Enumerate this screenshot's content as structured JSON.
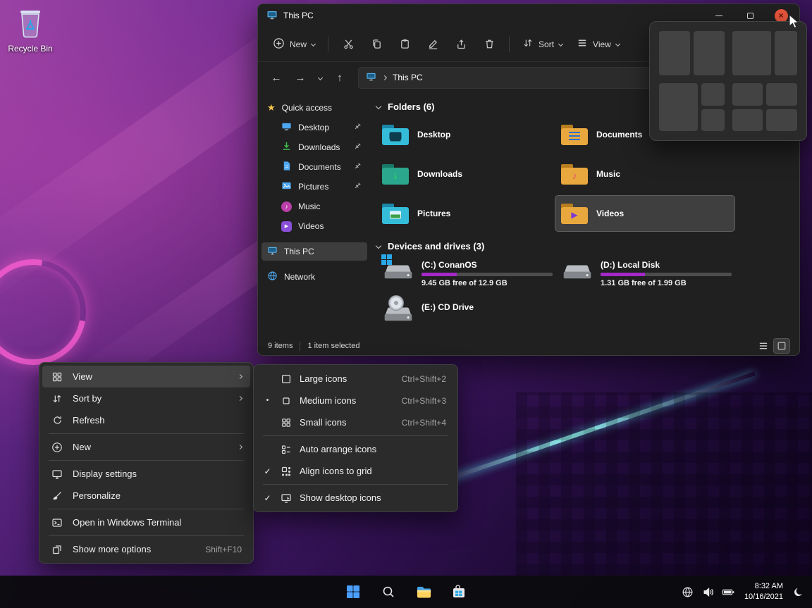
{
  "desktop": {
    "recycle_bin_label": "Recycle Bin"
  },
  "colors": {
    "drive_used_bar": "#a428c9",
    "close_button": "#e8563c",
    "selection_bg": "#3d3d3d",
    "folder_teal": "#35bcd9",
    "folder_amber": "#e8a83e"
  },
  "icons": {
    "star": "★",
    "music_note": "♪",
    "play": "▶",
    "down_arrow": "↓",
    "check": "✓",
    "bullet": "•",
    "close": "×",
    "back_arrow": "←",
    "forward_arrow": "→",
    "up_arrow": "↑"
  },
  "explorer": {
    "title": "This PC",
    "toolbar": {
      "new": "New",
      "sort": "Sort",
      "view": "View"
    },
    "nav": {
      "address": "This PC"
    },
    "sidebar": {
      "quick_access": "Quick access",
      "items": [
        {
          "label": "Desktop",
          "pinned": true
        },
        {
          "label": "Downloads",
          "pinned": true
        },
        {
          "label": "Documents",
          "pinned": true
        },
        {
          "label": "Pictures",
          "pinned": true
        },
        {
          "label": "Music",
          "pinned": false
        },
        {
          "label": "Videos",
          "pinned": false
        }
      ],
      "this_pc": "This PC",
      "network": "Network"
    },
    "folders": {
      "header": "Folders (6)",
      "items": [
        {
          "name": "Desktop"
        },
        {
          "name": "Documents"
        },
        {
          "name": "Downloads"
        },
        {
          "name": "Music"
        },
        {
          "name": "Pictures"
        },
        {
          "name": "Videos",
          "selected": true
        }
      ]
    },
    "devices": {
      "header": "Devices and drives (3)",
      "drives": [
        {
          "name": "(C:) ConanOS",
          "detail": "9.45 GB free of 12.9 GB",
          "used_pct": 27
        },
        {
          "name": "(D:) Local Disk",
          "detail": "1.31 GB free of 1.99 GB",
          "used_pct": 34
        },
        {
          "name": "(E:) CD Drive"
        }
      ]
    },
    "status": {
      "count": "9 items",
      "selection": "1 item selected"
    }
  },
  "context_menu": {
    "items": [
      {
        "label": "View"
      },
      {
        "label": "Sort by"
      },
      {
        "label": "Refresh"
      },
      {
        "label": "New"
      },
      {
        "label": "Display settings"
      },
      {
        "label": "Personalize"
      },
      {
        "label": "Open in Windows Terminal"
      },
      {
        "label": "Show more options",
        "shortcut": "Shift+F10"
      }
    ]
  },
  "view_submenu": {
    "items": [
      {
        "label": "Large icons",
        "shortcut": "Ctrl+Shift+2"
      },
      {
        "label": "Medium icons",
        "shortcut": "Ctrl+Shift+3",
        "selected": true
      },
      {
        "label": "Small icons",
        "shortcut": "Ctrl+Shift+4"
      },
      {
        "label": "Auto arrange icons"
      },
      {
        "label": "Align icons to grid",
        "checked": true
      },
      {
        "label": "Show desktop icons",
        "checked": true
      }
    ]
  },
  "taskbar": {
    "time": "8:32 AM",
    "date": "10/16/2021"
  }
}
